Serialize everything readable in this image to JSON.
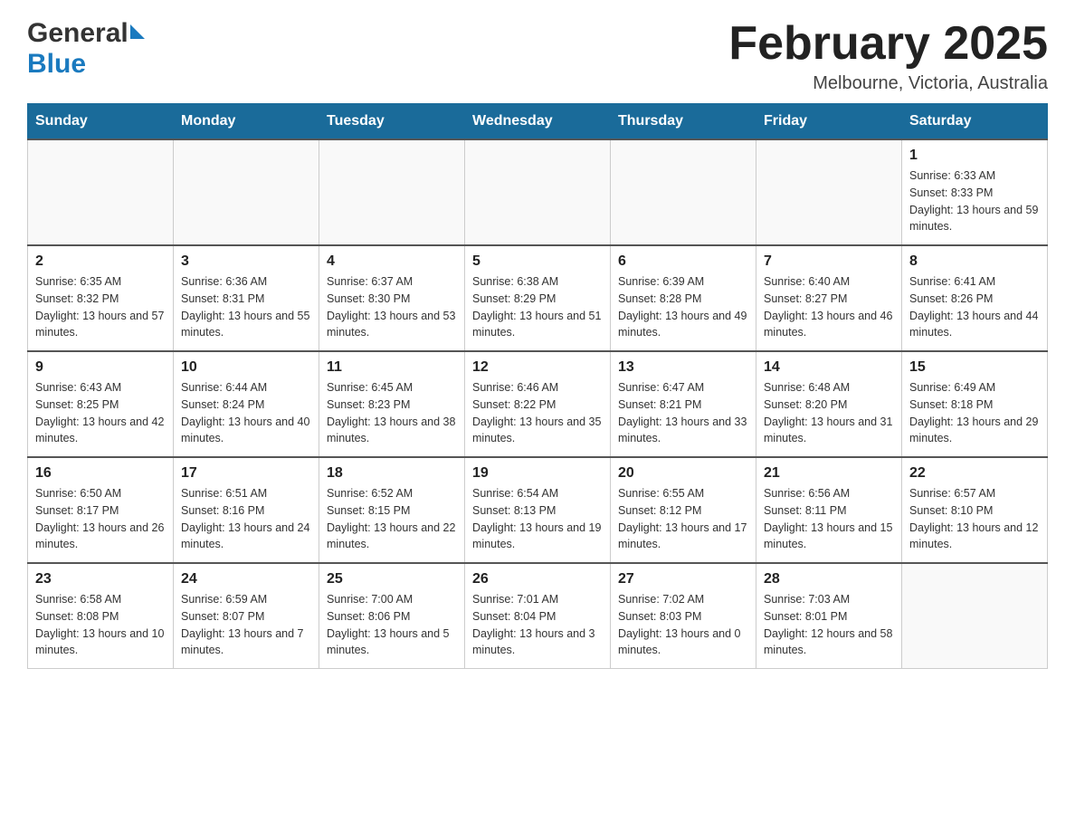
{
  "header": {
    "logo_general": "General",
    "logo_blue": "Blue",
    "month_title": "February 2025",
    "location": "Melbourne, Victoria, Australia"
  },
  "days_of_week": [
    "Sunday",
    "Monday",
    "Tuesday",
    "Wednesday",
    "Thursday",
    "Friday",
    "Saturday"
  ],
  "weeks": [
    [
      {
        "day": "",
        "info": ""
      },
      {
        "day": "",
        "info": ""
      },
      {
        "day": "",
        "info": ""
      },
      {
        "day": "",
        "info": ""
      },
      {
        "day": "",
        "info": ""
      },
      {
        "day": "",
        "info": ""
      },
      {
        "day": "1",
        "info": "Sunrise: 6:33 AM\nSunset: 8:33 PM\nDaylight: 13 hours and 59 minutes."
      }
    ],
    [
      {
        "day": "2",
        "info": "Sunrise: 6:35 AM\nSunset: 8:32 PM\nDaylight: 13 hours and 57 minutes."
      },
      {
        "day": "3",
        "info": "Sunrise: 6:36 AM\nSunset: 8:31 PM\nDaylight: 13 hours and 55 minutes."
      },
      {
        "day": "4",
        "info": "Sunrise: 6:37 AM\nSunset: 8:30 PM\nDaylight: 13 hours and 53 minutes."
      },
      {
        "day": "5",
        "info": "Sunrise: 6:38 AM\nSunset: 8:29 PM\nDaylight: 13 hours and 51 minutes."
      },
      {
        "day": "6",
        "info": "Sunrise: 6:39 AM\nSunset: 8:28 PM\nDaylight: 13 hours and 49 minutes."
      },
      {
        "day": "7",
        "info": "Sunrise: 6:40 AM\nSunset: 8:27 PM\nDaylight: 13 hours and 46 minutes."
      },
      {
        "day": "8",
        "info": "Sunrise: 6:41 AM\nSunset: 8:26 PM\nDaylight: 13 hours and 44 minutes."
      }
    ],
    [
      {
        "day": "9",
        "info": "Sunrise: 6:43 AM\nSunset: 8:25 PM\nDaylight: 13 hours and 42 minutes."
      },
      {
        "day": "10",
        "info": "Sunrise: 6:44 AM\nSunset: 8:24 PM\nDaylight: 13 hours and 40 minutes."
      },
      {
        "day": "11",
        "info": "Sunrise: 6:45 AM\nSunset: 8:23 PM\nDaylight: 13 hours and 38 minutes."
      },
      {
        "day": "12",
        "info": "Sunrise: 6:46 AM\nSunset: 8:22 PM\nDaylight: 13 hours and 35 minutes."
      },
      {
        "day": "13",
        "info": "Sunrise: 6:47 AM\nSunset: 8:21 PM\nDaylight: 13 hours and 33 minutes."
      },
      {
        "day": "14",
        "info": "Sunrise: 6:48 AM\nSunset: 8:20 PM\nDaylight: 13 hours and 31 minutes."
      },
      {
        "day": "15",
        "info": "Sunrise: 6:49 AM\nSunset: 8:18 PM\nDaylight: 13 hours and 29 minutes."
      }
    ],
    [
      {
        "day": "16",
        "info": "Sunrise: 6:50 AM\nSunset: 8:17 PM\nDaylight: 13 hours and 26 minutes."
      },
      {
        "day": "17",
        "info": "Sunrise: 6:51 AM\nSunset: 8:16 PM\nDaylight: 13 hours and 24 minutes."
      },
      {
        "day": "18",
        "info": "Sunrise: 6:52 AM\nSunset: 8:15 PM\nDaylight: 13 hours and 22 minutes."
      },
      {
        "day": "19",
        "info": "Sunrise: 6:54 AM\nSunset: 8:13 PM\nDaylight: 13 hours and 19 minutes."
      },
      {
        "day": "20",
        "info": "Sunrise: 6:55 AM\nSunset: 8:12 PM\nDaylight: 13 hours and 17 minutes."
      },
      {
        "day": "21",
        "info": "Sunrise: 6:56 AM\nSunset: 8:11 PM\nDaylight: 13 hours and 15 minutes."
      },
      {
        "day": "22",
        "info": "Sunrise: 6:57 AM\nSunset: 8:10 PM\nDaylight: 13 hours and 12 minutes."
      }
    ],
    [
      {
        "day": "23",
        "info": "Sunrise: 6:58 AM\nSunset: 8:08 PM\nDaylight: 13 hours and 10 minutes."
      },
      {
        "day": "24",
        "info": "Sunrise: 6:59 AM\nSunset: 8:07 PM\nDaylight: 13 hours and 7 minutes."
      },
      {
        "day": "25",
        "info": "Sunrise: 7:00 AM\nSunset: 8:06 PM\nDaylight: 13 hours and 5 minutes."
      },
      {
        "day": "26",
        "info": "Sunrise: 7:01 AM\nSunset: 8:04 PM\nDaylight: 13 hours and 3 minutes."
      },
      {
        "day": "27",
        "info": "Sunrise: 7:02 AM\nSunset: 8:03 PM\nDaylight: 13 hours and 0 minutes."
      },
      {
        "day": "28",
        "info": "Sunrise: 7:03 AM\nSunset: 8:01 PM\nDaylight: 12 hours and 58 minutes."
      },
      {
        "day": "",
        "info": ""
      }
    ]
  ]
}
